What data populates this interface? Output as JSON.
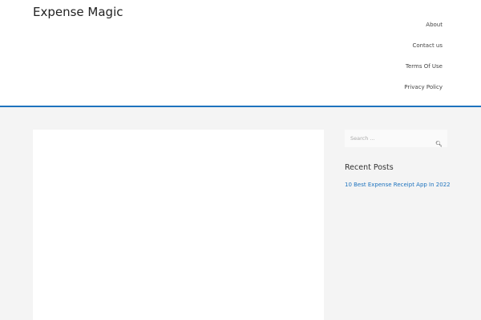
{
  "site": {
    "title": "Expense Magic"
  },
  "nav": {
    "items": [
      "About",
      "Contact us",
      "Terms Of Use",
      "Privacy Policy"
    ]
  },
  "sidebar": {
    "search_placeholder": "Search ...",
    "recent_title": "Recent Posts",
    "posts": [
      "10 Best Expense Receipt App In 2022"
    ]
  }
}
